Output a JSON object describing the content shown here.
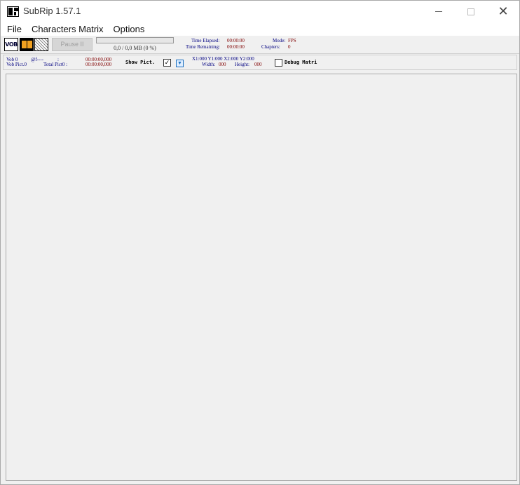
{
  "window": {
    "title": "SubRip 1.57.1",
    "controls": {
      "minimize": "minimize-icon",
      "maximize": "maximize-icon",
      "close": "close-icon"
    }
  },
  "menu": {
    "items": [
      {
        "label": "File"
      },
      {
        "label": "Characters Matrix"
      },
      {
        "label": "Options"
      }
    ]
  },
  "toolbar": {
    "icons": [
      "vob-icon",
      "film-icon",
      "grid-icon"
    ],
    "vob_text": "VOB",
    "pause_label": "Pause II",
    "progress_fraction": 0,
    "mb_text": "0,0 / 0,0 MB (0 %)",
    "time_elapsed_label": "Time Elapsed:",
    "time_elapsed_value": "00:00:00",
    "time_remaining_label": "Time Remaining:",
    "time_remaining_value": "00:00:00",
    "mode_label": "Mode:",
    "mode_value": "FPS",
    "chapters_label": "Chapters:",
    "chapters_value": "0"
  },
  "info": {
    "vob_label": "Vob 0",
    "vob_at": "@f----",
    "vob_colon": ":",
    "vob_time": "00:00:00,000",
    "pict_label": "Vob Pict.0",
    "total_pict_label": "Total Pict0 :",
    "pict_time": "00:00:00,000",
    "show_pict_label": "Show Pict.",
    "show_pict_checked": true,
    "coords": "X1:000 Y1:000 X2:000 Y2:000",
    "width_label": "Width:",
    "width_value": "000",
    "height_label": "Height:",
    "height_value": "000",
    "debug_label": "Debug Matri",
    "debug_checked": false
  }
}
